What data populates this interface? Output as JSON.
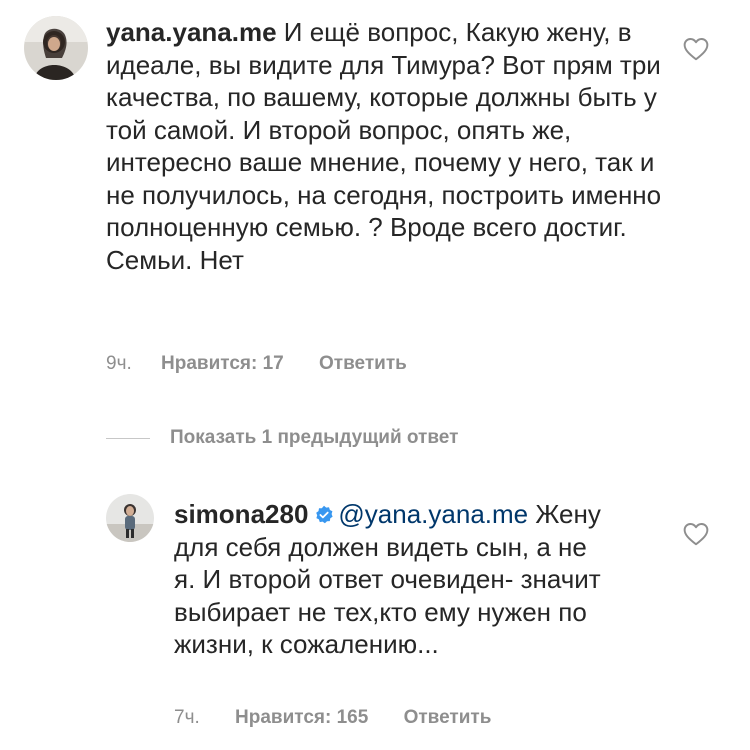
{
  "comments": [
    {
      "username": "yana.yana.me",
      "text": "И ещё вопрос, Какую жену, в идеале, вы видите для Тимура? Вот прям три качества, по вашему, которые должны быть у той самой. И второй вопрос, опять же, интересно ваше мнение, почему у него, так и не получилось, на сегодня, построить именно полноценную семью. ? Вроде всего достиг. Семьи. Нет",
      "time": "9ч.",
      "likes": "Нравится: 17",
      "reply": "Ответить",
      "avatar_icon": "user-avatar",
      "like_icon": "heart-icon"
    },
    {
      "username": "simona280",
      "verified_icon": "verified-badge-icon",
      "mention": "@yana.yana.me",
      "text": "Жену для себя должен видеть сын, а не я. И второй ответ очевиден- значит выбирает не тех,кто ему нужен по жизни, к сожалению...",
      "time": "7ч.",
      "likes": "Нравится: 165",
      "reply": "Ответить",
      "avatar_icon": "user-avatar",
      "like_icon": "heart-icon"
    }
  ],
  "view_replies": {
    "label": "Показать 1 предыдущий ответ"
  },
  "colors": {
    "text": "#262626",
    "secondary": "#8e8e8e",
    "mention": "#00376b",
    "verified": "#3897f0",
    "divider": "#c7c7c7"
  }
}
